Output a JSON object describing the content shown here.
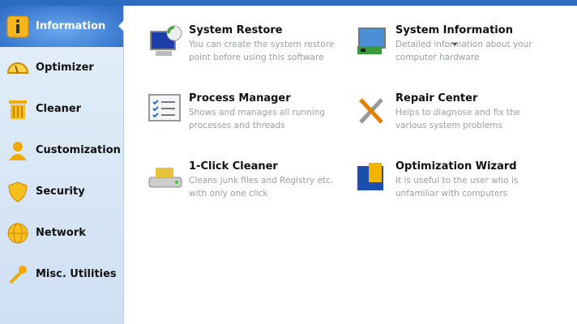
{
  "sidebar": {
    "items": [
      {
        "label": "Information",
        "icon": "info-icon",
        "active": true
      },
      {
        "label": "Optimizer",
        "icon": "gauge-icon"
      },
      {
        "label": "Cleaner",
        "icon": "trash-icon"
      },
      {
        "label": "Customization",
        "icon": "user-icon"
      },
      {
        "label": "Security",
        "icon": "shield-icon"
      },
      {
        "label": "Network",
        "icon": "globe-icon"
      },
      {
        "label": "Misc. Utilities",
        "icon": "wrench-icon"
      }
    ]
  },
  "tiles": [
    {
      "title": "System Restore",
      "desc": "You can create the system restore point before using this software",
      "icon": "system-restore-icon"
    },
    {
      "title": "System Information",
      "desc": "Detailed information about your computer hardware",
      "icon": "system-information-icon"
    },
    {
      "title": "Process Manager",
      "desc": "Shows and manages all running processes and threads",
      "icon": "process-manager-icon"
    },
    {
      "title": "Repair Center",
      "desc": "Helps to diagnose and fix the various system problems",
      "icon": "repair-center-icon"
    },
    {
      "title": "1-Click Cleaner",
      "desc": "Cleans junk files and Registry etc. with only one click",
      "icon": "cleaner-icon"
    },
    {
      "title": "Optimization Wizard",
      "desc": "It is useful to the user who is unfamiliar with computers",
      "icon": "wizard-icon"
    }
  ]
}
